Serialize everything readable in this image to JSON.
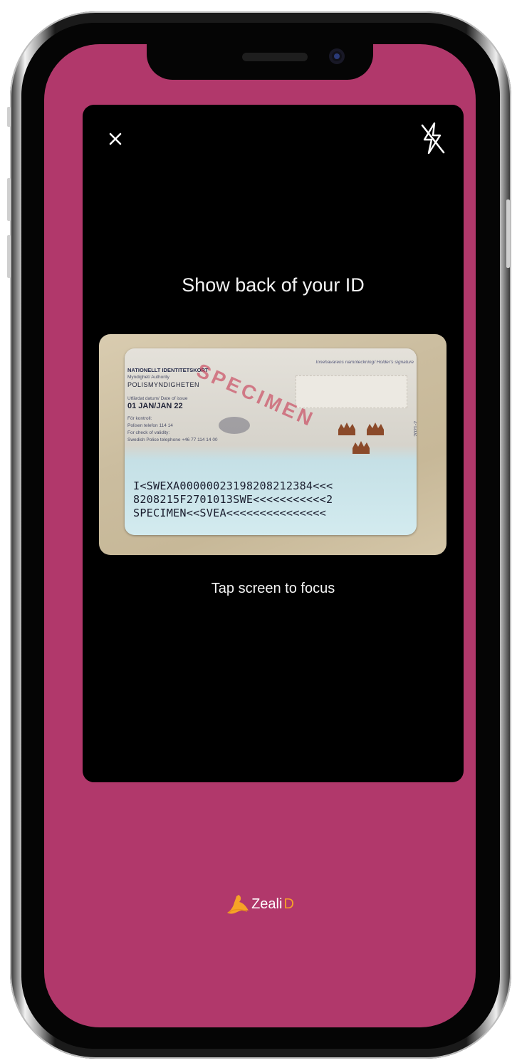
{
  "scanner": {
    "instruction": "Show back of your ID",
    "focus_hint": "Tap screen to focus",
    "close_icon": "close-icon",
    "flash_icon": "flash-off-icon"
  },
  "id_card": {
    "title": "NATIONELLT IDENTITETSKORT",
    "authority_label": "Myndighet/ Authority",
    "authority": "POLISMYNDIGHETEN",
    "issue_label": "Utfärdat datum/ Date of issue",
    "issue_date": "01 JAN/JAN 22",
    "control_label": "För kontroll:",
    "control_phone": "Polisen telefon 114 14",
    "validity_label": "For check of validity:",
    "validity_phone": "Swedish Police telephone +46 77 114 14 00",
    "signature_label": "Innehavarens namnteckning/ Holder's signature",
    "watermark": "SPECIMEN",
    "doc_code": "2021-2",
    "mrz_lines": [
      "I<SWEXA00000023198208212384<<<",
      "8208215F2701013SWE<<<<<<<<<<<2",
      "SPECIMEN<<SVEA<<<<<<<<<<<<<<<"
    ]
  },
  "brand": {
    "name_main": "Zeali",
    "name_accent": "D",
    "logo_icon": "zealid-logo-icon"
  },
  "colors": {
    "screen_background": "#b1386b",
    "viewfinder": "#000000",
    "brand_accent": "#f6a327"
  }
}
